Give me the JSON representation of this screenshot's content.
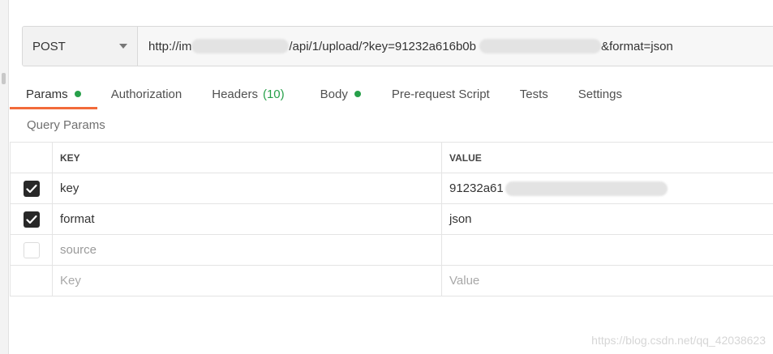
{
  "request": {
    "method": "POST",
    "url_start": "http://im",
    "url_middle": "/api/1/upload/?key=91232a616b0b",
    "url_end": "&format=json"
  },
  "tabs": [
    {
      "label": "Params",
      "dot": true,
      "active": true
    },
    {
      "label": "Authorization"
    },
    {
      "label": "Headers",
      "count": "(10)"
    },
    {
      "label": "Body",
      "dot": true
    },
    {
      "label": "Pre-request Script"
    },
    {
      "label": "Tests"
    },
    {
      "label": "Settings"
    }
  ],
  "query_params": {
    "title": "Query Params",
    "headers": {
      "key": "KEY",
      "value": "VALUE"
    },
    "rows": [
      {
        "key": "key",
        "value": "91232a61",
        "checked": true
      },
      {
        "key": "format",
        "value": "json",
        "checked": true
      },
      {
        "key": "source",
        "value": "",
        "checked": false
      }
    ],
    "new_row": {
      "key_placeholder": "Key",
      "value_placeholder": "Value"
    }
  },
  "watermark": "https://blog.csdn.net/qq_42038623",
  "colors": {
    "accent": "#f26b3a",
    "status_green": "#27a04a"
  }
}
